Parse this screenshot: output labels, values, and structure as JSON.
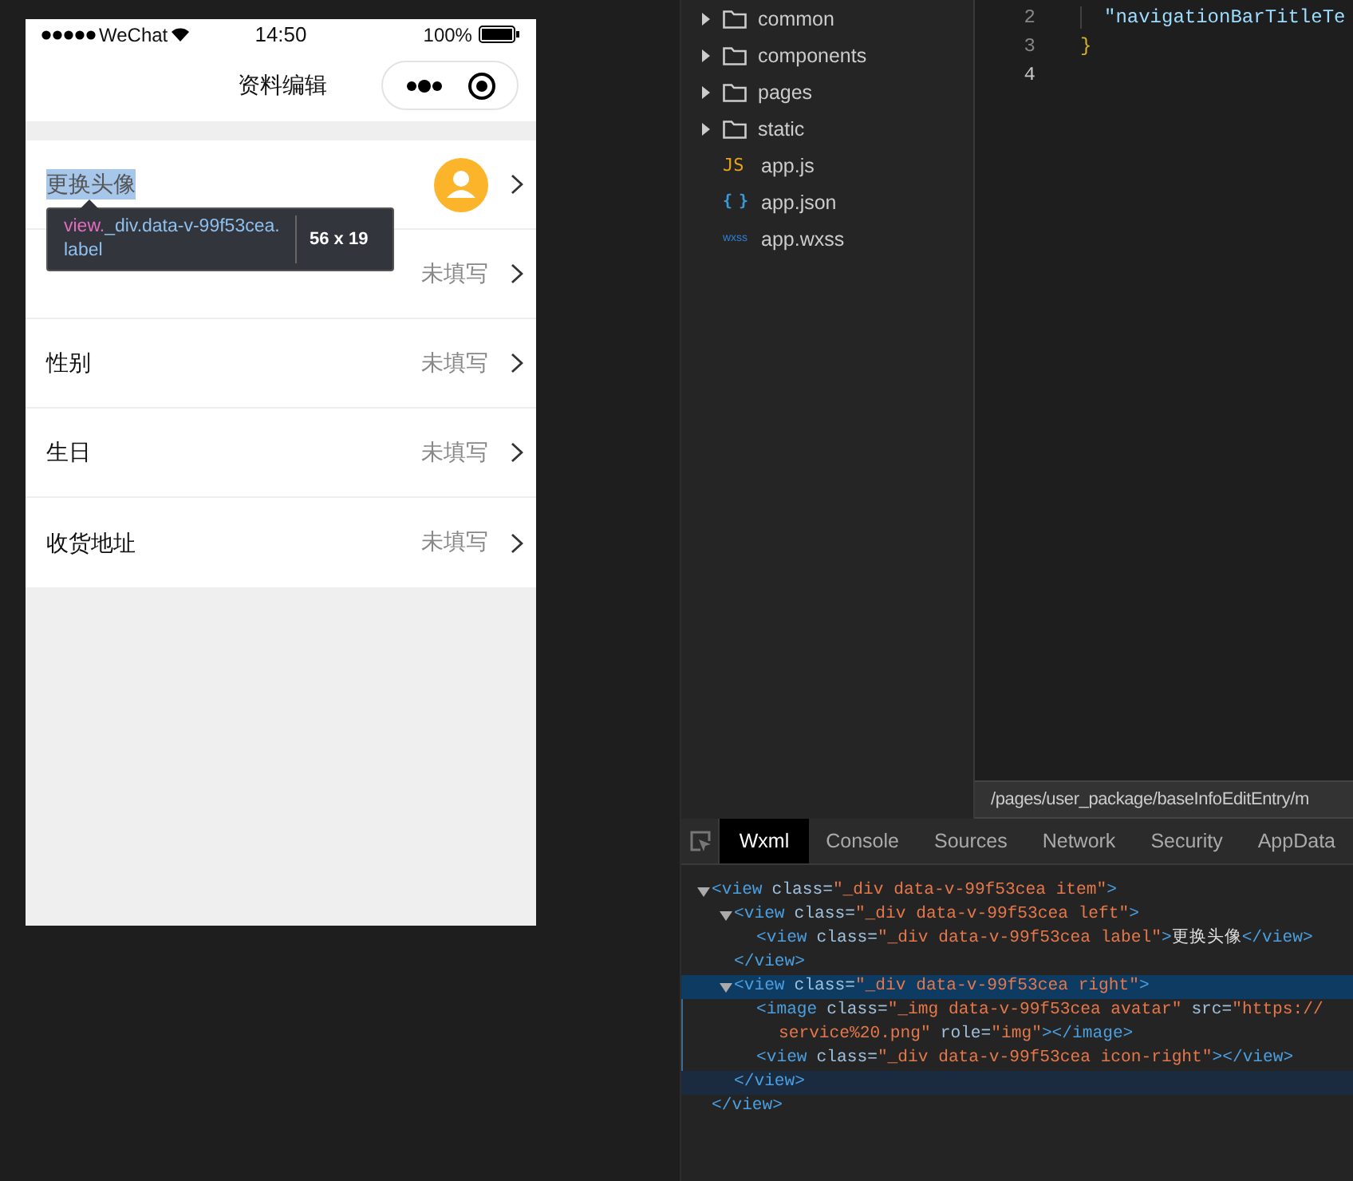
{
  "phone": {
    "status_bar": {
      "carrier": "WeChat",
      "time": "14:50",
      "battery": "100%"
    },
    "nav_bar": {
      "title": "资料编辑"
    },
    "rows": [
      {
        "kind": "avatar",
        "label": "更换头像",
        "highlighted": true
      },
      {
        "kind": "text",
        "value": "未填写",
        "highlighted": false
      },
      {
        "kind": "text",
        "label": "性别",
        "value": "未填写",
        "highlighted": false
      },
      {
        "kind": "text",
        "label": "生日",
        "value": "未填写",
        "highlighted": false
      },
      {
        "kind": "text",
        "label": "收货地址",
        "value": "未填写",
        "highlighted": false
      }
    ],
    "tooltip": {
      "tag": "view.",
      "selector": "_div.data-v-99f53cea.label",
      "size": "56 x 19"
    }
  },
  "file_tree": [
    {
      "kind": "folder",
      "name": "common"
    },
    {
      "kind": "folder",
      "name": "components"
    },
    {
      "kind": "folder",
      "name": "pages"
    },
    {
      "kind": "folder",
      "name": "static"
    },
    {
      "kind": "js",
      "badge": "JS",
      "name": "app.js"
    },
    {
      "kind": "json",
      "badge": "{ }",
      "name": "app.json"
    },
    {
      "kind": "wxss",
      "badge": "wxss",
      "name": "app.wxss"
    }
  ],
  "editor": {
    "lines": [
      {
        "number": "2",
        "text": "\"navigationBarTitleTe",
        "kind": "string",
        "current": false
      },
      {
        "number": "3",
        "text": "}",
        "kind": "brace",
        "current": false
      },
      {
        "number": "4",
        "current": true
      }
    ],
    "path": "/pages/user_package/baseInfoEditEntry/m"
  },
  "devtools": {
    "tabs": [
      {
        "label": "Wxml",
        "selected": true
      },
      {
        "label": "Console",
        "selected": false
      },
      {
        "label": "Sources",
        "selected": false
      },
      {
        "label": "Network",
        "selected": false
      },
      {
        "label": "Security",
        "selected": false
      },
      {
        "label": "AppData",
        "selected": false
      }
    ],
    "tree": [
      {
        "selected": false,
        "expanded": true,
        "tokens": [
          {
            "kind": "tag",
            "text": "<view"
          },
          {
            "kind": "attr",
            "text": "class="
          },
          {
            "kind": "value",
            "text": "\"_div data-v-99f53cea item\""
          },
          {
            "kind": "tag",
            "text": ">"
          }
        ],
        "close": "</view>",
        "children": [
          {
            "selected": false,
            "expanded": true,
            "tokens": [
              {
                "kind": "tag",
                "text": "<view"
              },
              {
                "kind": "attr",
                "text": "class="
              },
              {
                "kind": "value",
                "text": "\"_div data-v-99f53cea left\""
              },
              {
                "kind": "tag",
                "text": ">"
              }
            ],
            "close": "</view>",
            "children": [
              {
                "selected": false,
                "tokens": [
                  {
                    "kind": "tag",
                    "text": "<view"
                  },
                  {
                    "kind": "attr",
                    "text": "class="
                  },
                  {
                    "kind": "value",
                    "text": "\"_div data-v-99f53cea label\""
                  },
                  {
                    "kind": "tag",
                    "text": ">"
                  },
                  {
                    "kind": "text",
                    "text": "更换头像"
                  },
                  {
                    "kind": "tag",
                    "text": "</view>"
                  }
                ]
              }
            ]
          },
          {
            "selected": true,
            "expanded": true,
            "tokens": [
              {
                "kind": "tag",
                "text": "<view"
              },
              {
                "kind": "attr",
                "text": "class="
              },
              {
                "kind": "value",
                "text": "\"_div data-v-99f53cea right\""
              },
              {
                "kind": "tag",
                "text": ">"
              }
            ],
            "close": "</view>",
            "children": [
              {
                "selected": false,
                "tokens": [
                  {
                    "kind": "tag",
                    "text": "<image"
                  },
                  {
                    "kind": "attr",
                    "text": "class="
                  },
                  {
                    "kind": "value",
                    "text": "\"_img data-v-99f53cea avatar\""
                  },
                  {
                    "kind": "attr",
                    "text": "src="
                  },
                  {
                    "kind": "value",
                    "text": "\"https://"
                  }
                ],
                "tokens2": [
                  {
                    "kind": "value",
                    "text": "service%20.png\""
                  },
                  {
                    "kind": "attr",
                    "text": "role="
                  },
                  {
                    "kind": "value",
                    "text": "\"img\""
                  },
                  {
                    "kind": "tag",
                    "text": "></image>"
                  }
                ]
              },
              {
                "selected": false,
                "tokens": [
                  {
                    "kind": "tag",
                    "text": "<view"
                  },
                  {
                    "kind": "attr",
                    "text": "class="
                  },
                  {
                    "kind": "value",
                    "text": "\"_div data-v-99f53cea icon-right\""
                  },
                  {
                    "kind": "tag",
                    "text": "></view>"
                  }
                ]
              }
            ]
          }
        ]
      }
    ]
  }
}
